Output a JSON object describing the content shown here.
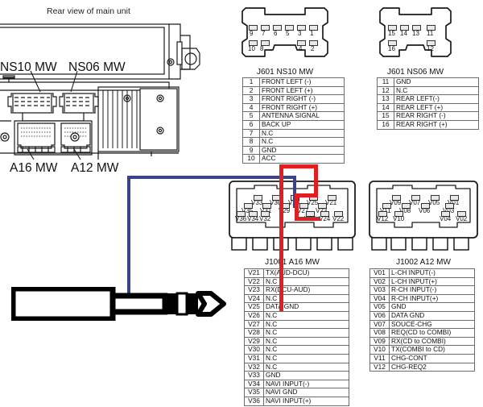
{
  "diagram": {
    "rear_view_caption": "Rear view of main unit",
    "unit_labels": [
      {
        "name": "ns10-label",
        "text": "NS10 MW"
      },
      {
        "name": "ns06-label",
        "text": "NS06 MW"
      },
      {
        "name": "a16-label",
        "text": "A16 MW"
      },
      {
        "name": "a12-label",
        "text": "A12 MW"
      }
    ]
  },
  "connectors": [
    {
      "id": "j601-ns10",
      "title": "J601 NS10 MW",
      "pin_map": {
        "top_row": [
          "9",
          "7",
          "6",
          "5",
          "3",
          "1"
        ],
        "bottom_left": [
          "10",
          "8"
        ],
        "bottom_right": [
          "4",
          "2"
        ]
      },
      "rows": [
        {
          "pin": "1",
          "signal": "FRONT LEFT (-)"
        },
        {
          "pin": "2",
          "signal": "FRONT LEFT (+)"
        },
        {
          "pin": "3",
          "signal": "FRONT RIGHT (-)"
        },
        {
          "pin": "4",
          "signal": "FRONT RIGHT (+)"
        },
        {
          "pin": "5",
          "signal": "ANTENNA SIGNAL"
        },
        {
          "pin": "6",
          "signal": "BACK UP"
        },
        {
          "pin": "7",
          "signal": "N.C"
        },
        {
          "pin": "8",
          "signal": "N.C"
        },
        {
          "pin": "9",
          "signal": "GND"
        },
        {
          "pin": "10",
          "signal": "ACC"
        }
      ]
    },
    {
      "id": "j601-ns06",
      "title": "J601 NS06 MW",
      "pin_map": {
        "top_row": [
          "15",
          "14",
          "13",
          "11"
        ],
        "bottom_left": [
          "16"
        ],
        "bottom_right": [
          "12"
        ]
      },
      "rows": [
        {
          "pin": "11",
          "signal": "GND"
        },
        {
          "pin": "12",
          "signal": "N.C"
        },
        {
          "pin": "13",
          "signal": "REAR LEFT(-)"
        },
        {
          "pin": "14",
          "signal": "REAR LEFT (+)"
        },
        {
          "pin": "15",
          "signal": "REAR RIGHT (-)"
        },
        {
          "pin": "16",
          "signal": "REAR RIGHT (+)"
        }
      ]
    },
    {
      "id": "j1001-a16",
      "title": "J1001  A16 MW",
      "pin_map": {
        "row_top": [
          "V33",
          "V30",
          "V28",
          "V25",
          "V21"
        ],
        "row_middle": [
          "V35",
          "V31",
          "V29",
          "V27",
          "V23"
        ],
        "row_bottom": [
          "V36",
          "V34",
          "V32",
          "V26",
          "V24",
          "V22"
        ]
      },
      "rows": [
        {
          "pin": "V21",
          "signal": "TX(AUD-DCU)"
        },
        {
          "pin": "V22",
          "signal": "N.C"
        },
        {
          "pin": "V23",
          "signal": "RX(DCU-AUD)"
        },
        {
          "pin": "V24",
          "signal": "N.C"
        },
        {
          "pin": "V25",
          "signal": "DATA GND"
        },
        {
          "pin": "V26",
          "signal": "N.C"
        },
        {
          "pin": "V27",
          "signal": "N.C"
        },
        {
          "pin": "V28",
          "signal": "N.C"
        },
        {
          "pin": "V29",
          "signal": "N.C"
        },
        {
          "pin": "V30",
          "signal": "N.C"
        },
        {
          "pin": "V31",
          "signal": "N.C"
        },
        {
          "pin": "V32",
          "signal": "N.C"
        },
        {
          "pin": "V33",
          "signal": "GND"
        },
        {
          "pin": "V34",
          "signal": "NAVI INPUT(-)"
        },
        {
          "pin": "V35",
          "signal": "NAVI GND"
        },
        {
          "pin": "V36",
          "signal": "NAVI INPUT(+)"
        }
      ]
    },
    {
      "id": "j1002-a12",
      "title": "J1002  A12 MW",
      "pin_map": {
        "row_top": [
          "V09",
          "V07",
          "V05",
          "V01"
        ],
        "row_middle": [
          "V11",
          "V08",
          "V06",
          "V03"
        ],
        "row_bottom": [
          "V12",
          "V10",
          "V04",
          "V02"
        ]
      },
      "rows": [
        {
          "pin": "V01",
          "signal": "L-CH INPUT(-)"
        },
        {
          "pin": "V02",
          "signal": "L-CH INPUT(+)"
        },
        {
          "pin": "V03",
          "signal": "R-CH INPUT(-)"
        },
        {
          "pin": "V04",
          "signal": "R-CH INPUT(+)"
        },
        {
          "pin": "V05",
          "signal": "GND"
        },
        {
          "pin": "V06",
          "signal": "DATA GND"
        },
        {
          "pin": "V07",
          "signal": "SOUCE-CHG"
        },
        {
          "pin": "V08",
          "signal": "REQ(CD to COMBI)"
        },
        {
          "pin": "V09",
          "signal": "RX(CD to COMBI)"
        },
        {
          "pin": "V10",
          "signal": "TX(COMBI to CD)"
        },
        {
          "pin": "V11",
          "signal": "CHG-CONT"
        },
        {
          "pin": "V12",
          "signal": "CHG-REQ2"
        }
      ]
    }
  ],
  "wiring": {
    "blue": {
      "from": "jack-ring",
      "to": "V28",
      "color": "#3b4489"
    },
    "red": {
      "from": "jack-tip",
      "to": "V26",
      "color": "#e02020"
    }
  },
  "jack": {
    "name": "3.5mm stereo plug"
  }
}
